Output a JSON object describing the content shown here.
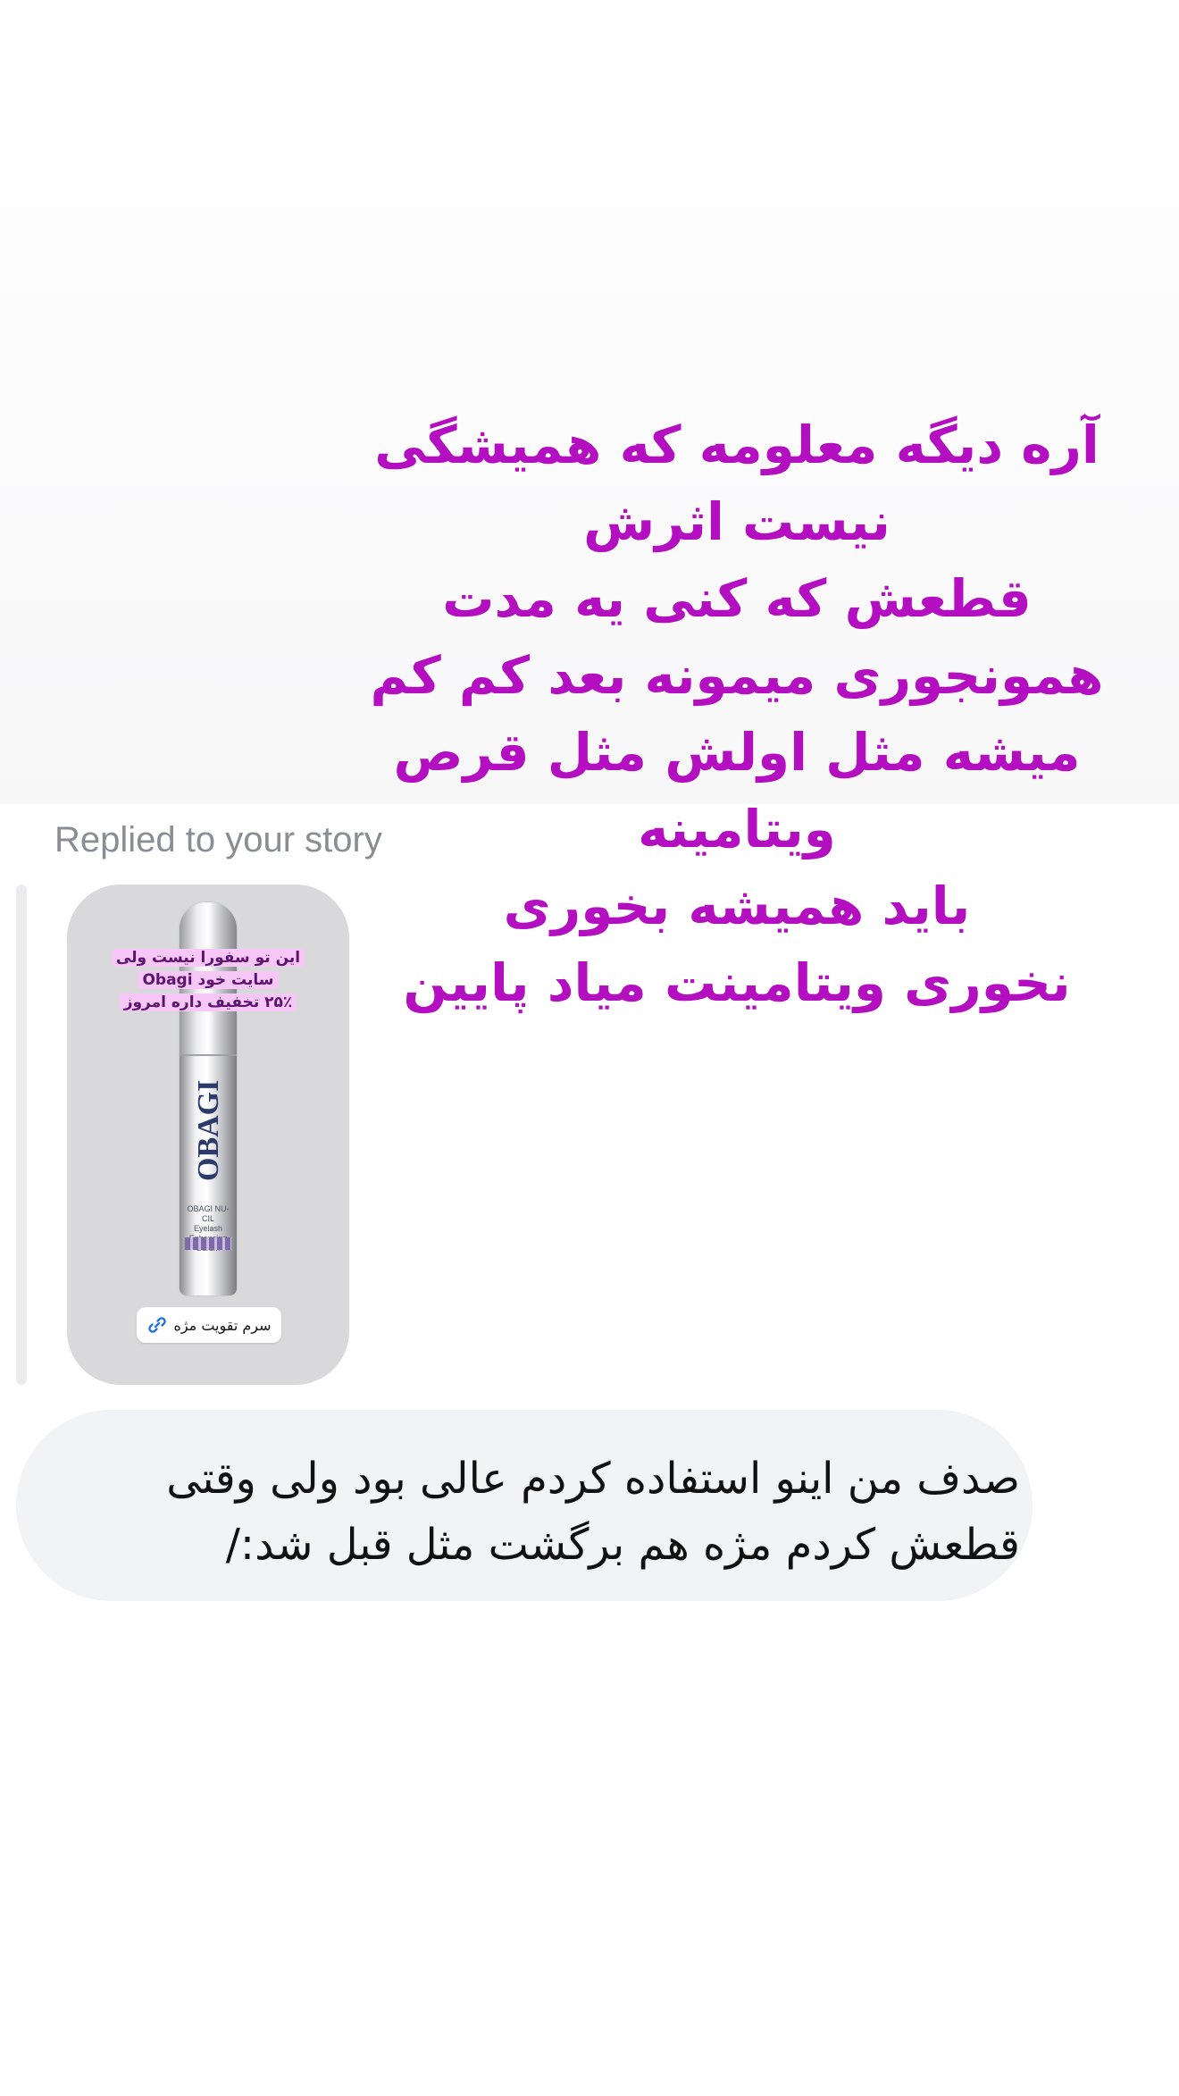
{
  "story_overlay": {
    "lines": [
      "آره دیگه معلومه که همیشگی",
      "نیست اثرش",
      "قطعش که کنی یه مدت",
      "همونجوری میمونه بعد کم کم",
      "میشه مثل اولش مثل قرص",
      "ویتامینه",
      "باید همیشه بخوری",
      "نخوری ویتامینت میاد پایین"
    ],
    "color": "#b30fc1"
  },
  "reply": {
    "label": "Replied to your story"
  },
  "story_card": {
    "product": {
      "brand": "OBAGI",
      "sub_brand": "MEDICAL",
      "name": "OBAGI NU-CIL",
      "description": "Eyelash Enhancing Serum",
      "volume": ".10 fl. oz. / 3 ml"
    },
    "sticker_lines": [
      "این تو سفورا نیست ولی",
      "سایت خود Obagi",
      "۲۵٪ تخفیف داره امروز"
    ],
    "link_sticker": {
      "label": "سرم تقویت مژه",
      "icon": "link-icon"
    }
  },
  "message": {
    "lines": [
      "صدف من اینو استفاده کردم عالی بود ولی وقتی",
      "قطعش کردم مژه هم برگشت مثل قبل شد:/"
    ]
  }
}
